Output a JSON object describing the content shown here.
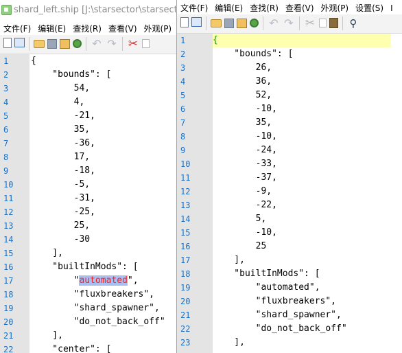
{
  "left_window": {
    "title": "shard_left.ship [J:\\starsector\\starsector-c",
    "menu": [
      "文件(F)",
      "编辑(E)",
      "查找(R)",
      "查看(V)",
      "外观(P)"
    ],
    "lines": [
      {
        "n": "1",
        "text": "{"
      },
      {
        "n": "2",
        "text": "    \"bounds\": ["
      },
      {
        "n": "3",
        "text": "        54,"
      },
      {
        "n": "4",
        "text": "        4,"
      },
      {
        "n": "5",
        "text": "        -21,"
      },
      {
        "n": "6",
        "text": "        35,"
      },
      {
        "n": "7",
        "text": "        -36,"
      },
      {
        "n": "8",
        "text": "        17,"
      },
      {
        "n": "9",
        "text": "        -18,"
      },
      {
        "n": "10",
        "text": "        -5,"
      },
      {
        "n": "11",
        "text": "        -31,"
      },
      {
        "n": "12",
        "text": "        -25,"
      },
      {
        "n": "13",
        "text": "        25,"
      },
      {
        "n": "14",
        "text": "        -30"
      },
      {
        "n": "15",
        "text": "    ],"
      },
      {
        "n": "16",
        "text": "    \"builtInMods\": ["
      },
      {
        "n": "17",
        "text_before": "        \"",
        "selected": "automated",
        "text_after": "\","
      },
      {
        "n": "18",
        "text": "        \"fluxbreakers\","
      },
      {
        "n": "19",
        "text": "        \"shard_spawner\","
      },
      {
        "n": "20",
        "text": "        \"do_not_back_off\""
      },
      {
        "n": "21",
        "text": "    ],"
      },
      {
        "n": "22",
        "text": "    \"center\": ["
      }
    ]
  },
  "right_window": {
    "menu": [
      "文件(F)",
      "编辑(E)",
      "查找(R)",
      "查看(V)",
      "外观(P)",
      "设置(S)",
      "I"
    ],
    "lines": [
      {
        "n": "1",
        "text": "{"
      },
      {
        "n": "2",
        "text": "    \"bounds\": ["
      },
      {
        "n": "3",
        "text": "        26,"
      },
      {
        "n": "4",
        "text": "        36,"
      },
      {
        "n": "5",
        "text": "        52,"
      },
      {
        "n": "6",
        "text": "        -10,"
      },
      {
        "n": "7",
        "text": "        35,"
      },
      {
        "n": "8",
        "text": "        -10,"
      },
      {
        "n": "9",
        "text": "        -24,"
      },
      {
        "n": "10",
        "text": "        -33,"
      },
      {
        "n": "11",
        "text": "        -37,"
      },
      {
        "n": "12",
        "text": "        -9,"
      },
      {
        "n": "13",
        "text": "        -22,"
      },
      {
        "n": "14",
        "text": "        5,"
      },
      {
        "n": "15",
        "text": "        -10,"
      },
      {
        "n": "16",
        "text": "        25"
      },
      {
        "n": "17",
        "text": "    ],"
      },
      {
        "n": "18",
        "text": "    \"builtInMods\": ["
      },
      {
        "n": "19",
        "text": "        \"automated\","
      },
      {
        "n": "20",
        "text": "        \"fluxbreakers\","
      },
      {
        "n": "21",
        "text": "        \"shard_spawner\","
      },
      {
        "n": "22",
        "text": "        \"do_not_back_off\""
      },
      {
        "n": "23",
        "text": "    ],"
      },
      {
        "n": "24",
        "text": ""
      }
    ]
  },
  "toolbar_icons": [
    "new-file-icon",
    "new-window-icon",
    "open-folder-icon",
    "save-icon",
    "save-all-icon",
    "reload-icon",
    "undo-icon",
    "redo-icon",
    "cut-icon",
    "copy-icon",
    "paste-icon",
    "find-icon"
  ],
  "colors": {
    "line_number": "#1a70c4",
    "gutter": "#e4e4e4",
    "selection_bg": "#a8bff2",
    "selection_fg": "#ff2020",
    "brace_match": "#00a000",
    "current_line": "#ffff9f"
  }
}
